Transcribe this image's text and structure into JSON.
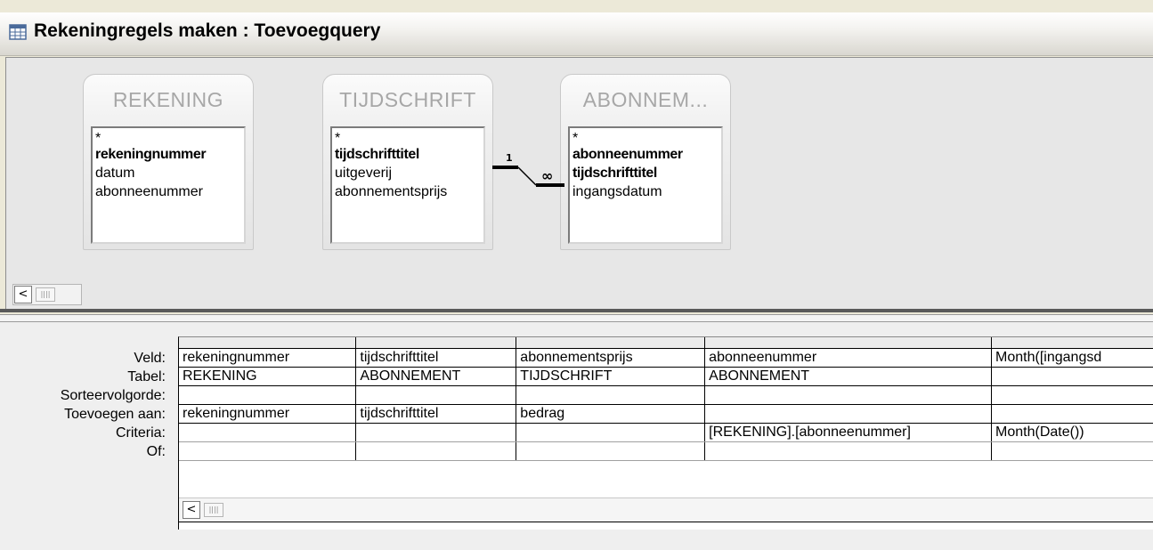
{
  "window": {
    "title": "Rekeningregels maken : Toevoegquery",
    "icon": "query-window-icon"
  },
  "tables": [
    {
      "name": "REKENING",
      "fields": [
        {
          "text": "*",
          "key": false
        },
        {
          "text": "rekeningnummer",
          "key": true
        },
        {
          "text": "datum",
          "key": false
        },
        {
          "text": "abonneenummer",
          "key": false
        }
      ]
    },
    {
      "name": "TIJDSCHRIFT",
      "fields": [
        {
          "text": "*",
          "key": false
        },
        {
          "text": "tijdschrifttitel",
          "key": true
        },
        {
          "text": "uitgeverij",
          "key": false
        },
        {
          "text": "abonnementsprijs",
          "key": false
        }
      ]
    },
    {
      "name": "ABONNEM...",
      "fields": [
        {
          "text": "*",
          "key": false
        },
        {
          "text": "abonneenummer",
          "key": true
        },
        {
          "text": "tijdschrifttitel",
          "key": true
        },
        {
          "text": "ingangsdatum",
          "key": false
        }
      ]
    }
  ],
  "relationship": {
    "one": "1",
    "many": "∞"
  },
  "top_scroll": {
    "left_arrow": "<",
    "thumb": "||||"
  },
  "grid": {
    "row_labels": [
      "Veld:",
      "Tabel:",
      "Sorteervolgorde:",
      "Toevoegen aan:",
      "Criteria:",
      "Of:"
    ],
    "columns": [
      {
        "veld": "rekeningnummer",
        "tabel": "REKENING",
        "sorteer": "",
        "toevoegen": "rekeningnummer",
        "criteria": "",
        "of": ""
      },
      {
        "veld": "tijdschrifttitel",
        "tabel": "ABONNEMENT",
        "sorteer": "",
        "toevoegen": "tijdschrifttitel",
        "criteria": "",
        "of": ""
      },
      {
        "veld": "abonnementsprijs",
        "tabel": "TIJDSCHRIFT",
        "sorteer": "",
        "toevoegen": "bedrag",
        "criteria": "",
        "of": ""
      },
      {
        "veld": "abonneenummer",
        "tabel": "ABONNEMENT",
        "sorteer": "",
        "toevoegen": "",
        "criteria": "[REKENING].[abonneenummer]",
        "of": ""
      },
      {
        "veld": "Month([ingangsd",
        "tabel": "",
        "sorteer": "",
        "toevoegen": "",
        "criteria": "Month(Date())",
        "of": ""
      }
    ],
    "scroll": {
      "left_arrow": "<",
      "thumb": "||||"
    }
  }
}
